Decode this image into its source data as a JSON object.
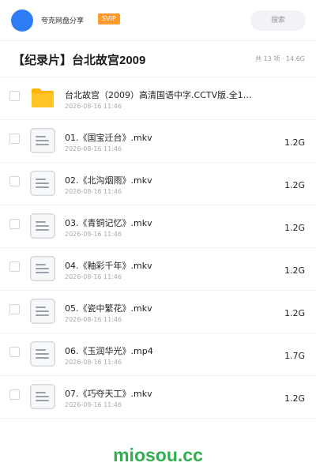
{
  "header": {
    "site_name": "夸克网盘分享",
    "badge": "SVIP",
    "search_placeholder": "搜索"
  },
  "folder": {
    "title": "【纪录片】台北故宫2009",
    "count_text": "共 13 项",
    "separator": "·",
    "total_size": "14.6G"
  },
  "files": [
    {
      "type": "folder",
      "name": "台北故宫（2009）高清国语中字.CCTV版.全1…",
      "date": "2026-08-16 11:46",
      "size": ""
    },
    {
      "type": "file",
      "name": "01.《国宝迁台》.mkv",
      "date": "2026-08-16 11:46",
      "size": "1.2G"
    },
    {
      "type": "file",
      "name": "02.《北沟烟雨》.mkv",
      "date": "2026-08-16 11:46",
      "size": "1.2G"
    },
    {
      "type": "file",
      "name": "03.《青铜记忆》.mkv",
      "date": "2026-08-16 11:46",
      "size": "1.2G"
    },
    {
      "type": "file",
      "name": "04.《釉彩千年》.mkv",
      "date": "2026-08-16 11:46",
      "size": "1.2G"
    },
    {
      "type": "file",
      "name": "05.《瓷中繁花》.mkv",
      "date": "2026-08-16 11:46",
      "size": "1.2G"
    },
    {
      "type": "file",
      "name": "06.《玉润华光》.mp4",
      "date": "2026-08-16 11:46",
      "size": "1.7G"
    },
    {
      "type": "file",
      "name": "07.《巧夺天工》.mkv",
      "date": "2026-08-16 11:46",
      "size": "1.2G"
    }
  ],
  "watermark": "miosou.cc",
  "colors": {
    "accent": "#2f7df6",
    "badge": "#ff9a2f",
    "folder": "#ffc526",
    "watermark": "#2eae4f"
  }
}
